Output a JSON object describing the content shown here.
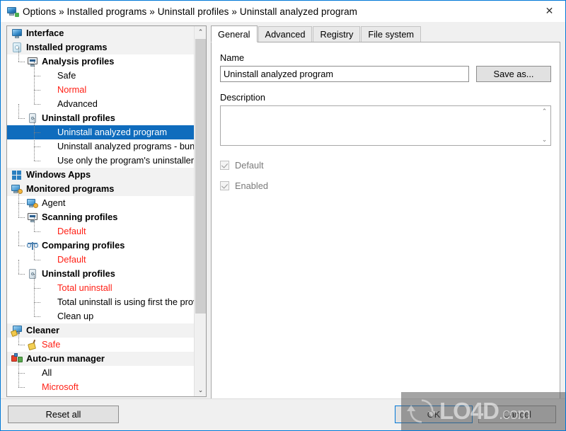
{
  "window": {
    "title": "Options » Installed programs » Uninstall profiles » Uninstall analyzed program",
    "title_icon": "monitor-icon",
    "close_label": "✕",
    "border_color": "#0078d7"
  },
  "tree": {
    "scrollbar": {
      "up_arrow": "⌃",
      "down_arrow": "⌄"
    },
    "items": [
      {
        "label": "Interface",
        "level": 0,
        "icon": "monitor-icon",
        "bold": true,
        "red": false,
        "selected": false
      },
      {
        "label": "Installed programs",
        "level": 0,
        "icon": "disc-icon",
        "bold": true,
        "red": false,
        "selected": false
      },
      {
        "label": "Analysis profiles",
        "level": 1,
        "icon": "screen-icon",
        "bold": true,
        "red": false,
        "selected": false
      },
      {
        "label": "Safe",
        "level": 2,
        "icon": "",
        "bold": false,
        "red": false,
        "selected": false
      },
      {
        "label": "Normal",
        "level": 2,
        "icon": "",
        "bold": false,
        "red": true,
        "selected": false
      },
      {
        "label": "Advanced",
        "level": 2,
        "icon": "",
        "bold": false,
        "red": false,
        "selected": false
      },
      {
        "label": "Uninstall profiles",
        "level": 1,
        "icon": "hdd-icon",
        "bold": true,
        "red": false,
        "selected": false
      },
      {
        "label": "Uninstall analyzed program",
        "level": 2,
        "icon": "",
        "bold": false,
        "red": false,
        "selected": true
      },
      {
        "label": "Uninstall analyzed programs - bun...",
        "level": 2,
        "icon": "",
        "bold": false,
        "red": false,
        "selected": false
      },
      {
        "label": "Use only the program's uninstaller",
        "level": 2,
        "icon": "",
        "bold": false,
        "red": false,
        "selected": false
      },
      {
        "label": "Windows Apps",
        "level": 0,
        "icon": "grid-icon",
        "bold": true,
        "red": false,
        "selected": false
      },
      {
        "label": "Monitored programs",
        "level": 0,
        "icon": "agent-icon",
        "bold": true,
        "red": false,
        "selected": false
      },
      {
        "label": "Agent",
        "level": 1,
        "icon": "agent-icon",
        "bold": false,
        "red": false,
        "selected": false
      },
      {
        "label": "Scanning profiles",
        "level": 1,
        "icon": "screen-icon",
        "bold": true,
        "red": false,
        "selected": false
      },
      {
        "label": "Default",
        "level": 2,
        "icon": "",
        "bold": false,
        "red": true,
        "selected": false
      },
      {
        "label": "Comparing profiles",
        "level": 1,
        "icon": "scale-icon",
        "bold": true,
        "red": false,
        "selected": false
      },
      {
        "label": "Default",
        "level": 2,
        "icon": "",
        "bold": false,
        "red": true,
        "selected": false
      },
      {
        "label": "Uninstall profiles",
        "level": 1,
        "icon": "hdd-icon",
        "bold": true,
        "red": false,
        "selected": false
      },
      {
        "label": "Total uninstall",
        "level": 2,
        "icon": "",
        "bold": false,
        "red": true,
        "selected": false
      },
      {
        "label": "Total uninstall is using first the prov...",
        "level": 2,
        "icon": "",
        "bold": false,
        "red": false,
        "selected": false
      },
      {
        "label": "Clean up",
        "level": 2,
        "icon": "",
        "bold": false,
        "red": false,
        "selected": false
      },
      {
        "label": "Cleaner",
        "level": 0,
        "icon": "cleaner-icon",
        "bold": true,
        "red": false,
        "selected": false
      },
      {
        "label": "Safe",
        "level": 1,
        "icon": "broom-icon",
        "bold": false,
        "red": true,
        "selected": false
      },
      {
        "label": "Auto-run manager",
        "level": 0,
        "icon": "autorun-icon",
        "bold": true,
        "red": false,
        "selected": false
      },
      {
        "label": "All",
        "level": 1,
        "icon": "",
        "bold": false,
        "red": false,
        "selected": false
      },
      {
        "label": "Microsoft",
        "level": 1,
        "icon": "",
        "bold": false,
        "red": true,
        "selected": false
      }
    ]
  },
  "tabs": [
    {
      "label": "General",
      "active": true
    },
    {
      "label": "Advanced",
      "active": false
    },
    {
      "label": "Registry",
      "active": false
    },
    {
      "label": "File system",
      "active": false
    }
  ],
  "general": {
    "name_label": "Name",
    "name_value": "Uninstall analyzed program",
    "name_placeholder": "",
    "save_as_label": "Save as...",
    "description_label": "Description",
    "description_value": "",
    "description_placeholder": "",
    "scroll_up": "⌃",
    "scroll_down": "⌄",
    "checkboxes": [
      {
        "label": "Default",
        "checked": true,
        "disabled": true
      },
      {
        "label": "Enabled",
        "checked": true,
        "disabled": true
      }
    ]
  },
  "footer": {
    "reset_label": "Reset all",
    "ok_label": "OK",
    "cancel_label": "Cancel"
  },
  "watermark": {
    "text": "LO4D",
    "suffix": ".com"
  }
}
